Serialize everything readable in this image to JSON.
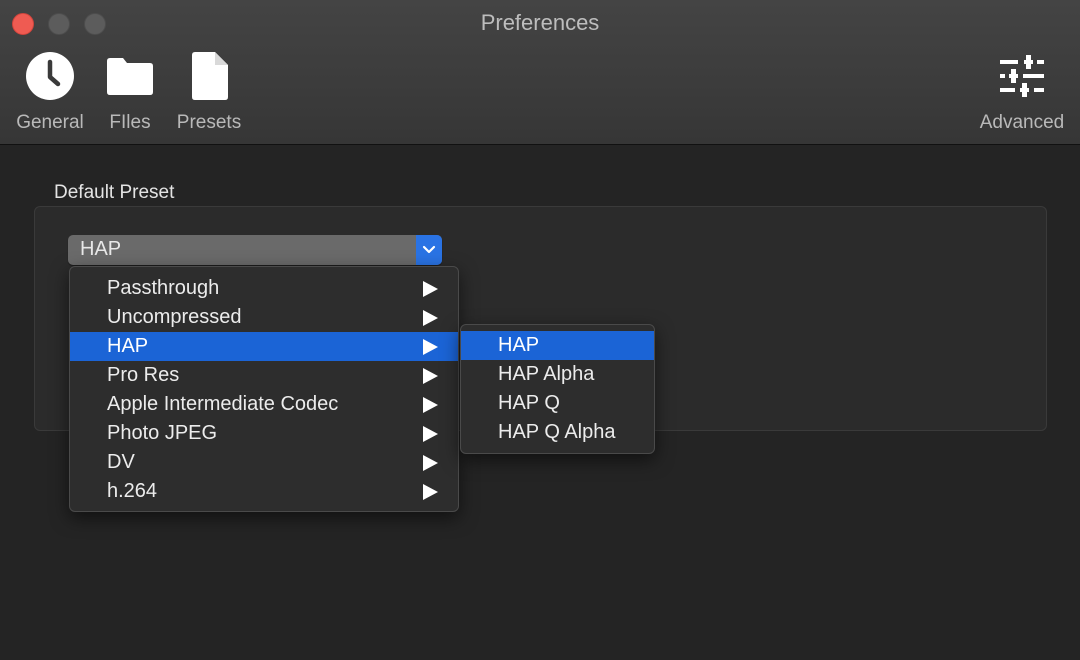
{
  "window": {
    "title": "Preferences"
  },
  "toolbar": {
    "general": {
      "label": "General",
      "icon": "clock-icon"
    },
    "files": {
      "label": "FIles",
      "icon": "folder-icon"
    },
    "presets": {
      "label": "Presets",
      "icon": "document-icon"
    },
    "advanced": {
      "label": "Advanced",
      "icon": "sliders-icon"
    }
  },
  "content": {
    "section_title": "Default Preset",
    "preset_popup": {
      "selected_value": "HAP"
    }
  },
  "preset_menu": {
    "items": [
      {
        "label": "Passthrough",
        "has_submenu": true
      },
      {
        "label": "Uncompressed",
        "has_submenu": true
      },
      {
        "label": "HAP",
        "has_submenu": true,
        "highlighted": true
      },
      {
        "label": "Pro Res",
        "has_submenu": true
      },
      {
        "label": "Apple Intermediate Codec",
        "has_submenu": true
      },
      {
        "label": "Photo JPEG",
        "has_submenu": true
      },
      {
        "label": "DV",
        "has_submenu": true
      },
      {
        "label": "h.264",
        "has_submenu": true
      }
    ]
  },
  "hap_submenu": {
    "items": [
      {
        "label": "HAP",
        "highlighted": true
      },
      {
        "label": "HAP Alpha"
      },
      {
        "label": "HAP Q"
      },
      {
        "label": "HAP Q Alpha"
      }
    ]
  },
  "colors": {
    "accent": "#1b64d6",
    "close_button": "#ef5b52",
    "background": "#242424"
  }
}
